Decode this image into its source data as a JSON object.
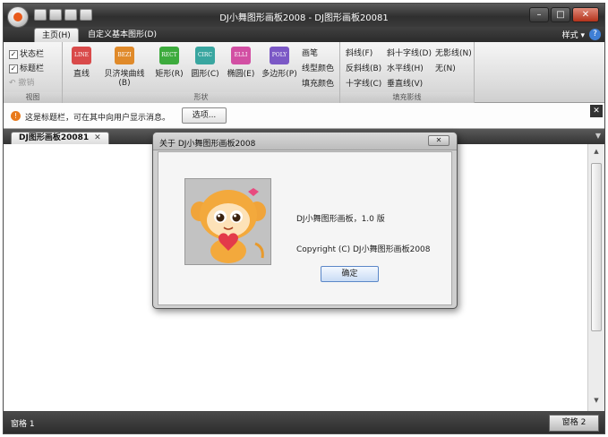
{
  "window": {
    "title": "DJ小舞图形画板2008 - DJ图形画板20081",
    "min": "–",
    "max": "□",
    "close": "✕"
  },
  "ribbon_tabs": [
    "主页(H)",
    "自定义基本图形(D)"
  ],
  "style_menu": "样式 ▾",
  "help": "?",
  "groups": {
    "view": {
      "label": "视图",
      "items": [
        {
          "label": "状态栏",
          "checked": true
        },
        {
          "label": "标题栏",
          "checked": true
        },
        {
          "label": "撤销",
          "checked": false
        }
      ]
    },
    "shapes": {
      "label": "形状",
      "buttons": [
        {
          "icon_text": "LINE",
          "label": "直线",
          "color": "#d94a4a"
        },
        {
          "icon_text": "BEZI",
          "label": "贝济埃曲线(B)",
          "color": "#e08a2a"
        },
        {
          "icon_text": "RECT",
          "label": "矩形(R)",
          "color": "#3dab3d"
        },
        {
          "icon_text": "CIRC",
          "label": "圆形(C)",
          "color": "#39a6a0"
        },
        {
          "icon_text": "ELLI",
          "label": "椭圆(E)",
          "color": "#d24fa3"
        },
        {
          "icon_text": "POLY",
          "label": "多边形(P)",
          "color": "#7b58c6"
        }
      ],
      "extras": [
        "画笔",
        "线型颜色",
        "填充颜色"
      ]
    },
    "fill_shadow": {
      "label": "填充影线",
      "col1": [
        "斜线(F)",
        "反斜线(B)",
        "十字线(C)"
      ],
      "col2": [
        "斜十字线(D)",
        "水平线(H)",
        "垂直线(V)"
      ],
      "col3": [
        "无影线(N)",
        "无(N)"
      ]
    }
  },
  "message_bar": {
    "text": "这是标题栏，可在其中向用户显示消息。",
    "button": "选项...",
    "close": "✕"
  },
  "document_tab": {
    "label": "DJ图形画板20081",
    "close": "✕"
  },
  "status": {
    "pane1": "窗格 1",
    "pane2": "窗格 2"
  },
  "dialog": {
    "title": "关于 DJ小舞图形画板2008",
    "close": "✕",
    "line1": "DJ小舞图形画板，1.0 版",
    "line2": "Copyright (C) DJ小舞图形画板2008",
    "ok": "确定"
  }
}
